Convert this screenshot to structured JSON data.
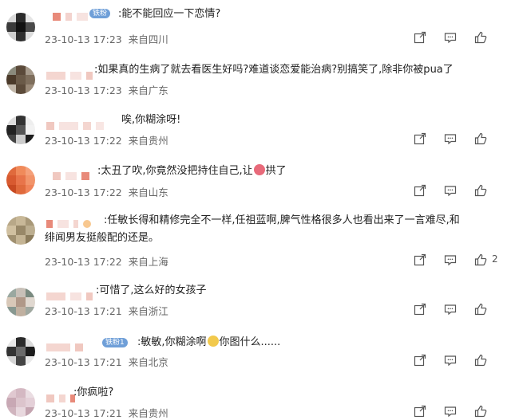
{
  "comments": [
    {
      "badge": "铁粉",
      "text": ":能不能回应一下恋情?",
      "date": "23-10-13 17:23",
      "location": "来自四川",
      "likes": ""
    },
    {
      "text": ":如果真的生病了就去看医生好吗?难道谈恋爱能治病?别搞笑了,除非你被pua了",
      "date": "23-10-13 17:23",
      "location": "来自广东",
      "likes": ""
    },
    {
      "text": "唉,你糊涂呀!",
      "date": "23-10-13 17:22",
      "location": "来自贵州",
      "likes": ""
    },
    {
      "text_before": ":太丑了吹,你竟然没把持住自己,让",
      "text_after": "拱了",
      "date": "23-10-13 17:22",
      "location": "来自山东",
      "likes": ""
    },
    {
      "line1": ":任敏长得和精修完全不一样,任祖蓝啊,脾气性格很多人也看出来了一言难尽,和",
      "line2": "绯闻男友挺般配的还是。",
      "date": "23-10-13 17:22",
      "location": "来自上海",
      "likes": "2"
    },
    {
      "text": ":可惜了,这么好的女孩子",
      "date": "23-10-13 17:21",
      "location": "来自浙江",
      "likes": ""
    },
    {
      "badge": "铁粉1",
      "text_before": ":敏敏,你糊涂啊",
      "text_after": "你图什么......",
      "date": "23-10-13 17:21",
      "location": "来自北京",
      "likes": ""
    },
    {
      "text": ":你疯啦?",
      "date": "23-10-13 17:21",
      "location": "来自贵州",
      "likes": ""
    }
  ],
  "icons": {
    "share": "share-icon",
    "comment": "comment-icon",
    "like": "like-icon"
  }
}
